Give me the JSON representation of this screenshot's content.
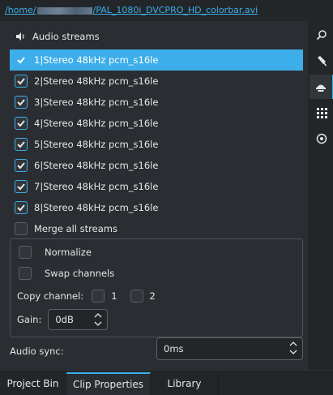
{
  "path": {
    "prefix": "/home/",
    "suffix": "/PAL_1080i_DVCPRO_HD_colorbar.avi"
  },
  "audio_streams": {
    "header": "Audio streams",
    "streams": [
      {
        "label": "1|Stereo 48kHz pcm_s16le",
        "checked": true,
        "selected": true
      },
      {
        "label": "2|Stereo 48kHz pcm_s16le",
        "checked": true,
        "selected": false
      },
      {
        "label": "3|Stereo 48kHz pcm_s16le",
        "checked": true,
        "selected": false
      },
      {
        "label": "4|Stereo 48kHz pcm_s16le",
        "checked": true,
        "selected": false
      },
      {
        "label": "5|Stereo 48kHz pcm_s16le",
        "checked": true,
        "selected": false
      },
      {
        "label": "6|Stereo 48kHz pcm_s16le",
        "checked": true,
        "selected": false
      },
      {
        "label": "7|Stereo 48kHz pcm_s16le",
        "checked": true,
        "selected": false
      },
      {
        "label": "8|Stereo 48kHz pcm_s16le",
        "checked": true,
        "selected": false
      }
    ],
    "merge_label": "Merge all streams"
  },
  "options": {
    "normalize": "Normalize",
    "swap_channels": "Swap channels",
    "copy_channel_label": "Copy channel:",
    "channel_1": "1",
    "channel_2": "2",
    "gain_label": "Gain:",
    "gain_value": "0dB"
  },
  "sync": {
    "label": "Audio sync:",
    "value": "0ms"
  },
  "toolbar_icons": [
    "search-icon",
    "brush-icon",
    "speaker-panel-icon",
    "grid-icon",
    "eye-icon"
  ],
  "tabs": [
    {
      "label": "Project Bin",
      "active": false
    },
    {
      "label": "Clip Properties",
      "active": true
    },
    {
      "label": "Library",
      "active": false
    }
  ],
  "colors": {
    "accent": "#3daee9",
    "background": "#2a2d31"
  }
}
